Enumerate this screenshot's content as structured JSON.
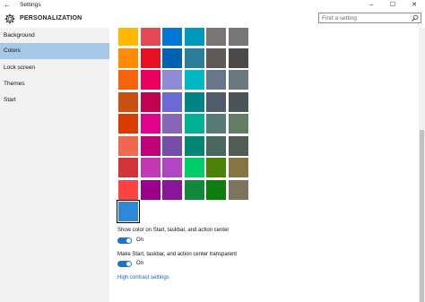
{
  "window": {
    "title": "Settings",
    "back_glyph": "←",
    "minimize_glyph": "–",
    "maximize_glyph": "☐",
    "close_glyph": "✕"
  },
  "header": {
    "section": "PERSONALIZATION",
    "icon": "gear-icon"
  },
  "search": {
    "placeholder": "Find a setting",
    "icon": "search-icon"
  },
  "sidebar": {
    "items": [
      {
        "label": "Background",
        "active": false
      },
      {
        "label": "Colors",
        "active": true
      },
      {
        "label": "Lock screen",
        "active": false
      },
      {
        "label": "Themes",
        "active": false
      },
      {
        "label": "Start",
        "active": false
      }
    ]
  },
  "colors": {
    "grid": [
      [
        "#FFB900",
        "#E74856",
        "#0078D7",
        "#0099BC",
        "#7A7574",
        "#767676"
      ],
      [
        "#FF8C00",
        "#E81123",
        "#0063B1",
        "#2D7D9A",
        "#5D5A58",
        "#4C4A48"
      ],
      [
        "#F7630C",
        "#EA005E",
        "#8E8CD8",
        "#00B7C3",
        "#68768A",
        "#69797E"
      ],
      [
        "#CA5010",
        "#C30052",
        "#6B69D6",
        "#038387",
        "#515C6B",
        "#4A5459"
      ],
      [
        "#DA3B01",
        "#E3008C",
        "#8764B8",
        "#00B294",
        "#567C73",
        "#647C64"
      ],
      [
        "#EF6950",
        "#BF0077",
        "#744DA9",
        "#018574",
        "#486860",
        "#525E54"
      ],
      [
        "#D13438",
        "#C239B3",
        "#B146C2",
        "#00CC6A",
        "#498205",
        "#847545"
      ],
      [
        "#FF4343",
        "#9A0089",
        "#881798",
        "#10893E",
        "#107C10",
        "#7E735F"
      ]
    ],
    "selected": "#2D89D6"
  },
  "options": {
    "show_color_label": "Show color on Start, taskbar, and action center",
    "show_color_state": "On",
    "transparent_label": "Make Start, taskbar, and action center transparent",
    "transparent_state": "On",
    "high_contrast_link": "High contrast settings"
  }
}
